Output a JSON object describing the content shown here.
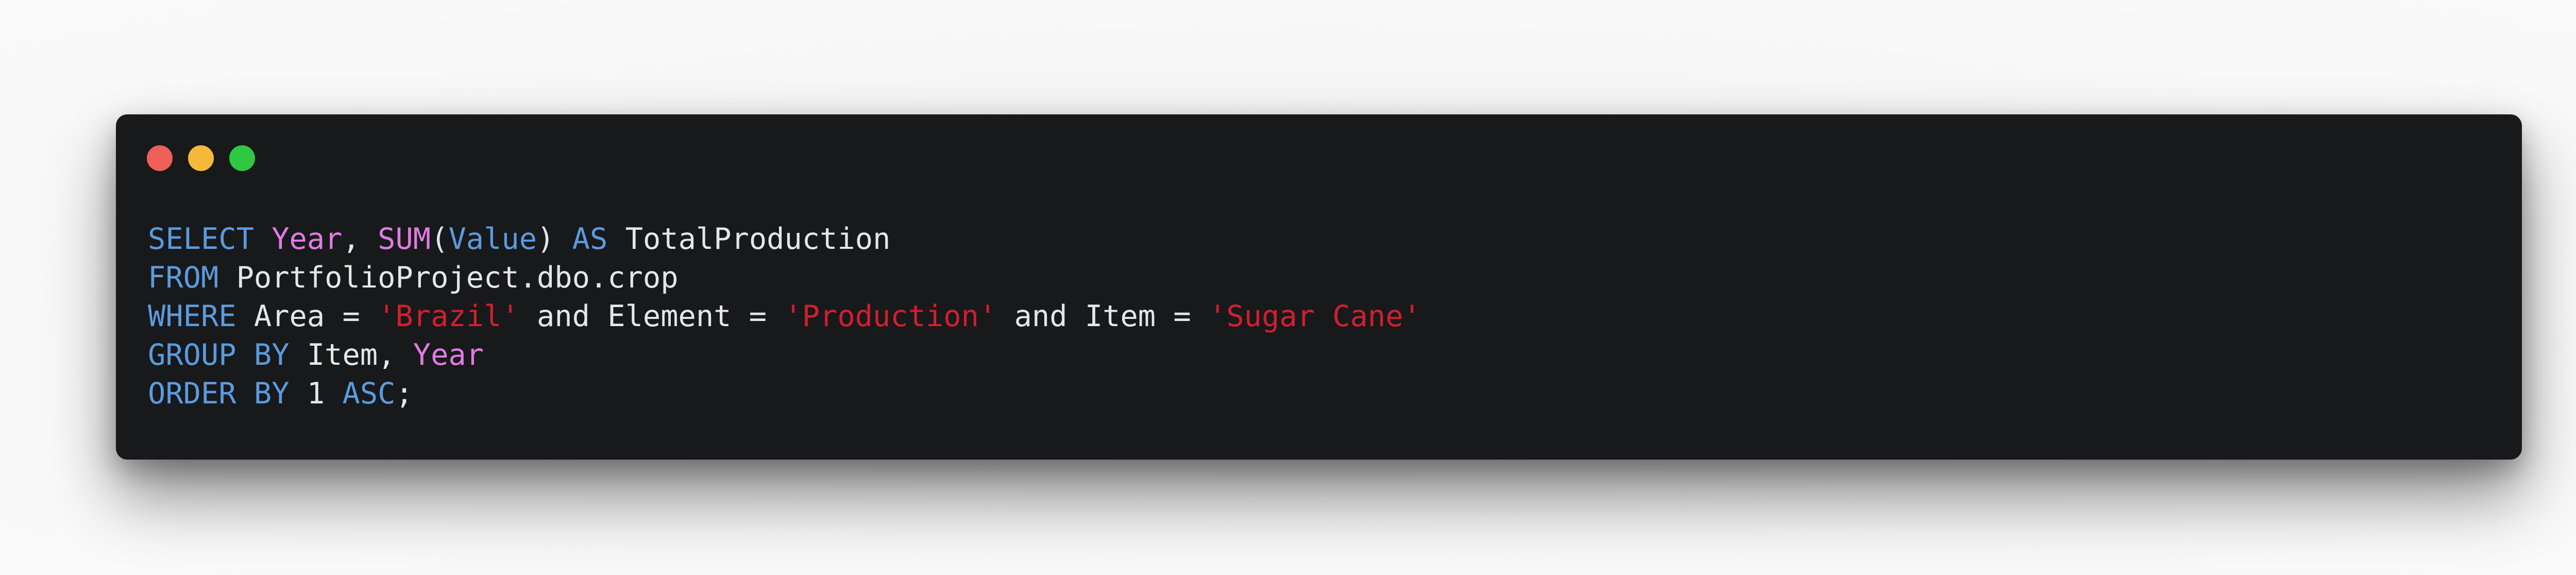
{
  "window": {
    "controls": [
      {
        "name": "close",
        "color": "#ed5f57"
      },
      {
        "name": "minimize",
        "color": "#f5b93a"
      },
      {
        "name": "zoom",
        "color": "#2fc842"
      }
    ]
  },
  "colors": {
    "keyword": "#5b9bdf",
    "function": "#e17be2",
    "string": "#d11f2f",
    "text": "#e6e6e6",
    "background": "#18191b"
  },
  "code": {
    "lines": [
      [
        {
          "t": "SELECT",
          "k": "kw"
        },
        {
          "t": " ",
          "k": "txt"
        },
        {
          "t": "Year",
          "k": "fn"
        },
        {
          "t": ", ",
          "k": "txt"
        },
        {
          "t": "SUM",
          "k": "fn"
        },
        {
          "t": "(",
          "k": "txt"
        },
        {
          "t": "Value",
          "k": "kw"
        },
        {
          "t": ") ",
          "k": "txt"
        },
        {
          "t": "AS",
          "k": "kw"
        },
        {
          "t": " TotalProduction",
          "k": "txt"
        }
      ],
      [
        {
          "t": "FROM",
          "k": "kw"
        },
        {
          "t": " PortfolioProject.dbo.crop",
          "k": "txt"
        }
      ],
      [
        {
          "t": "WHERE",
          "k": "kw"
        },
        {
          "t": " Area = ",
          "k": "txt"
        },
        {
          "t": "'Brazil'",
          "k": "str"
        },
        {
          "t": " and Element = ",
          "k": "txt"
        },
        {
          "t": "'Production'",
          "k": "str"
        },
        {
          "t": " and Item = ",
          "k": "txt"
        },
        {
          "t": "'Sugar Cane'",
          "k": "str"
        }
      ],
      [
        {
          "t": "GROUP BY",
          "k": "kw"
        },
        {
          "t": " Item, ",
          "k": "txt"
        },
        {
          "t": "Year",
          "k": "fn"
        }
      ],
      [
        {
          "t": "ORDER BY",
          "k": "kw"
        },
        {
          "t": " 1 ",
          "k": "txt"
        },
        {
          "t": "ASC",
          "k": "kw"
        },
        {
          "t": ";",
          "k": "txt"
        }
      ]
    ]
  }
}
